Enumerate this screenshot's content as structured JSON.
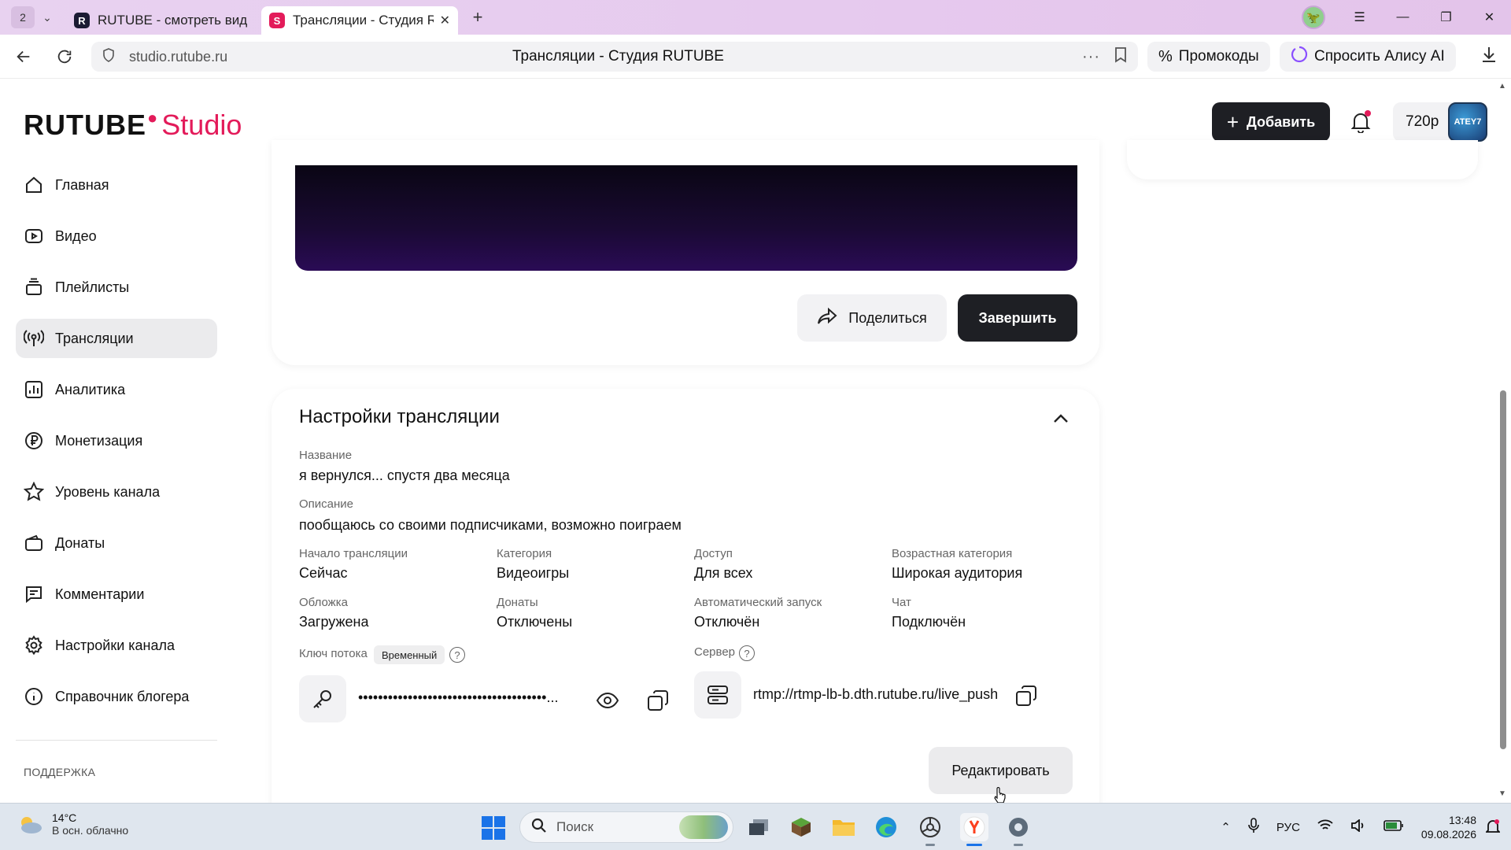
{
  "browser": {
    "tab_count": "2",
    "tabs": [
      {
        "label": "RUTUBE - смотреть виде",
        "favicon": "R",
        "active": false
      },
      {
        "label": "Трансляции - Студия R",
        "favicon": "S",
        "active": true
      }
    ],
    "url": "studio.rutube.ru",
    "page_title": "Трансляции - Студия RUTUBE",
    "promo_label": "Промокоды",
    "alice_label": "Спросить Алису AI"
  },
  "header": {
    "logo_main": "RUTUBE",
    "logo_sub": "Studio",
    "add_label": "Добавить",
    "quality": "720p",
    "avatar_text": "ATEY7"
  },
  "sidebar": {
    "items": [
      {
        "label": "Главная",
        "icon": "home-icon",
        "active": false
      },
      {
        "label": "Видео",
        "icon": "video-icon",
        "active": false
      },
      {
        "label": "Плейлисты",
        "icon": "playlist-icon",
        "active": false
      },
      {
        "label": "Трансляции",
        "icon": "broadcast-icon",
        "active": true
      },
      {
        "label": "Аналитика",
        "icon": "analytics-icon",
        "active": false
      },
      {
        "label": "Монетизация",
        "icon": "ruble-icon",
        "active": false
      },
      {
        "label": "Уровень канала",
        "icon": "star-icon",
        "active": false
      },
      {
        "label": "Донаты",
        "icon": "wallet-icon",
        "active": false
      },
      {
        "label": "Комментарии",
        "icon": "comment-icon",
        "active": false
      },
      {
        "label": "Настройки канала",
        "icon": "gear-icon",
        "active": false
      },
      {
        "label": "Справочник блогера",
        "icon": "info-icon",
        "active": false
      }
    ],
    "support_label": "ПОДДЕРЖКА"
  },
  "stream_actions": {
    "share_label": "Поделиться",
    "finish_label": "Завершить"
  },
  "settings": {
    "title": "Настройки трансляции",
    "name_label": "Название",
    "name_value": "я вернулся... спустя два месяца",
    "description_label": "Описание",
    "description_value": "пообщаюсь со своими подписчиками, возможно поиграем",
    "fields": [
      {
        "label": "Начало трансляции",
        "value": "Сейчас"
      },
      {
        "label": "Категория",
        "value": "Видеоигры"
      },
      {
        "label": "Доступ",
        "value": "Для всех"
      },
      {
        "label": "Возрастная категория",
        "value": "Широкая аудитория"
      },
      {
        "label": "Обложка",
        "value": "Загружена"
      },
      {
        "label": "Донаты",
        "value": "Отключены"
      },
      {
        "label": "Автоматический запуск",
        "value": "Отключён"
      },
      {
        "label": "Чат",
        "value": "Подключён"
      }
    ],
    "stream_key_label": "Ключ потока",
    "stream_key_badge": "Временный",
    "stream_key_value": "••••••••••••••••••••••••••••••••••••••...",
    "server_label": "Сервер",
    "server_value": "rtmp://rtmp-lb-b.dth.rutube.ru/live_push",
    "edit_label": "Редактировать"
  },
  "taskbar": {
    "weather_temp": "14°C",
    "weather_cond": "В осн. облачно",
    "search_placeholder": "Поиск",
    "lang": "РУС",
    "time": "13:48",
    "date": "09.08.2026"
  }
}
